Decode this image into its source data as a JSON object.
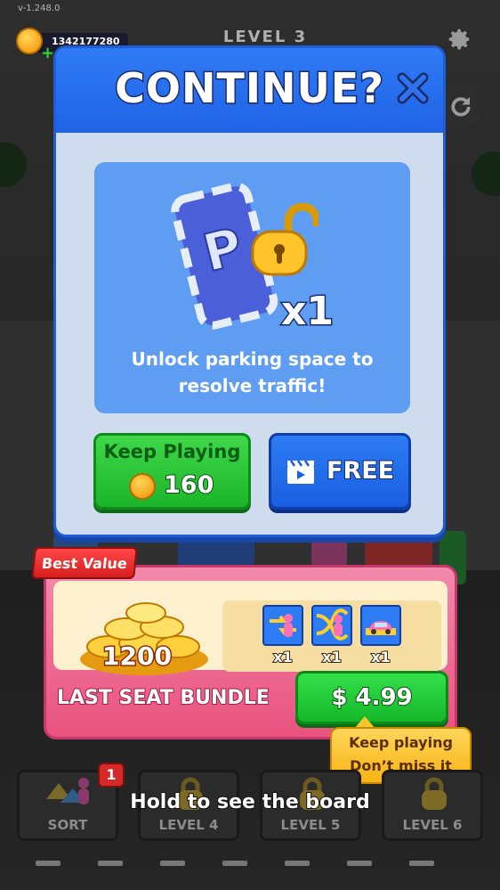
{
  "version": "v-1.248.0",
  "coins": {
    "amount": "1342177280"
  },
  "level": {
    "label": "LEVEL 3"
  },
  "icons": {
    "settings": "gear-icon",
    "refresh": "refresh-icon",
    "close": "close-icon",
    "video": "video-icon",
    "coin": "coin-icon",
    "lock": "lock-icon"
  },
  "dialog": {
    "title": "CONTINUE?",
    "card_text_line1": "Unlock parking space to",
    "card_text_line2": "resolve traffic!",
    "card_qty": "x1",
    "keep_playing_label": "Keep Playing",
    "keep_playing_cost": "160",
    "free_label": "FREE"
  },
  "bundle": {
    "tag": "Best Value",
    "coin_amount": "1200",
    "items": [
      {
        "icon": "swap-passenger-icon",
        "qty": "x1"
      },
      {
        "icon": "shuffle-passenger-icon",
        "qty": "x1"
      },
      {
        "icon": "pink-car-icon",
        "qty": "x1"
      }
    ],
    "name": "LAST SEAT BUNDLE",
    "price": "$ 4.99",
    "tooltip_line1": "Keep playing",
    "tooltip_line2": "Don’t miss it"
  },
  "bottom": {
    "slots": [
      {
        "label": "SORT",
        "badge": "1"
      },
      {
        "label": "LEVEL 4"
      },
      {
        "label": "LEVEL 5"
      },
      {
        "label": "LEVEL 6"
      }
    ],
    "hint": "Hold to see the board"
  },
  "colors": {
    "primary_blue": "#1f63e6",
    "green": "#1cb52a",
    "pink": "#e9527e",
    "gold": "#f7a41a"
  }
}
